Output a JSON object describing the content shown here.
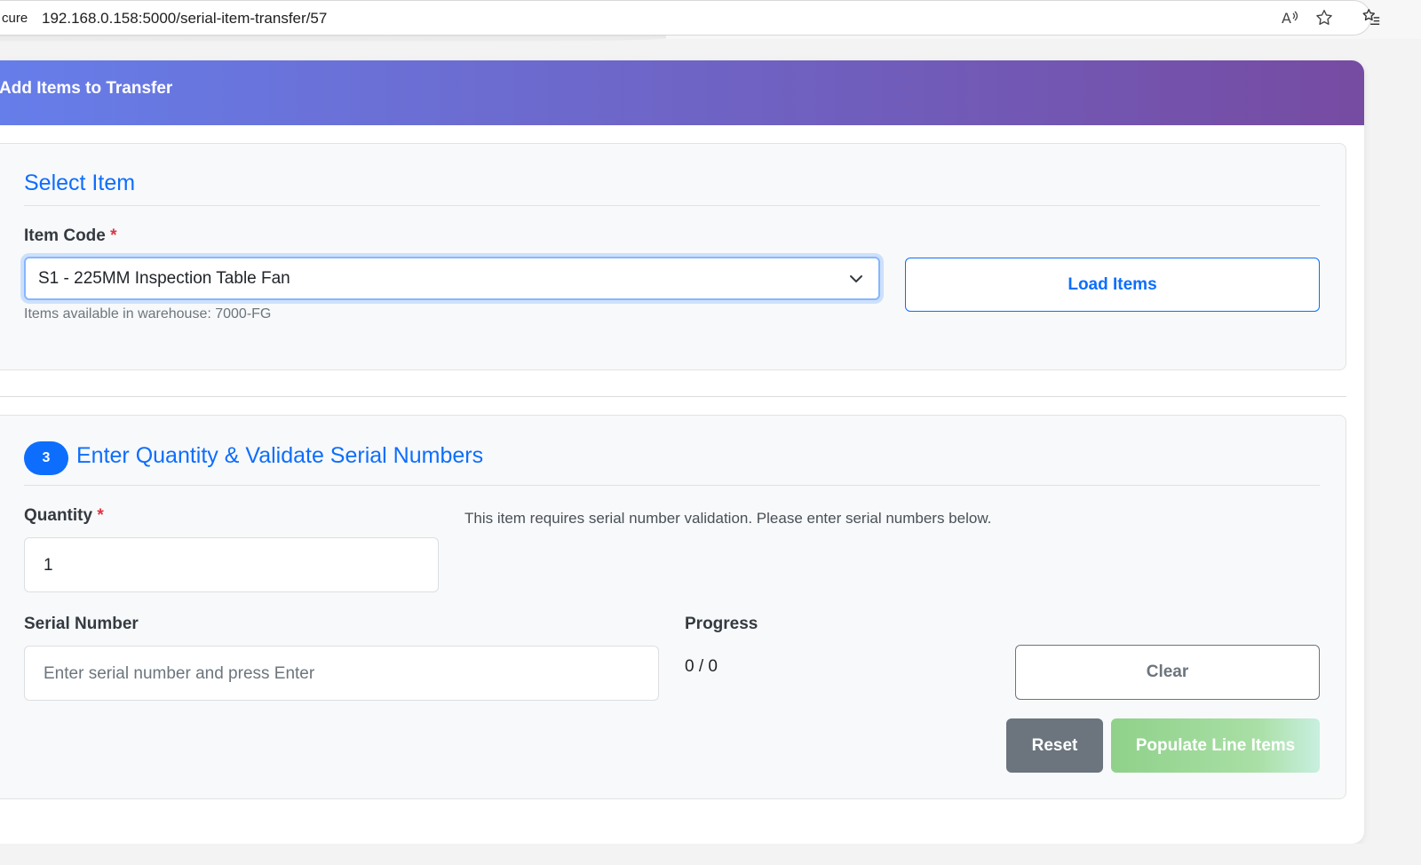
{
  "browser": {
    "secure_label": "cure",
    "url": "192.168.0.158:5000/serial-item-transfer/57",
    "icons": [
      "read-aloud-icon",
      "favorite-star-icon",
      "favorites-list-icon"
    ]
  },
  "card": {
    "header_title": "Add Items to Transfer",
    "header_gradient": [
      "#667eea",
      "#764ba2"
    ]
  },
  "select_item": {
    "title": "Select Item",
    "item_code_label": "Item Code",
    "required_mark": "*",
    "selected_value": "S1 - 225MM Inspection Table Fan",
    "help_text": "Items available in warehouse: 7000-FG",
    "load_button": "Load Items"
  },
  "quantity_section": {
    "step_number": "3",
    "title": "Enter Quantity & Validate Serial Numbers",
    "quantity_label": "Quantity",
    "required_mark": "*",
    "quantity_value": "1",
    "info_text": "This item requires serial number validation. Please enter serial numbers below.",
    "serial_label": "Serial Number",
    "serial_placeholder": "Enter serial number and press Enter",
    "progress_label": "Progress",
    "progress_value": "0 / 0",
    "clear_button": "Clear",
    "reset_button": "Reset",
    "populate_button": "Populate Line Items"
  },
  "colors": {
    "primary": "#0d6efd",
    "secondary": "#6c757d",
    "danger": "#dc3545",
    "success_light": "#a9dfa5"
  }
}
